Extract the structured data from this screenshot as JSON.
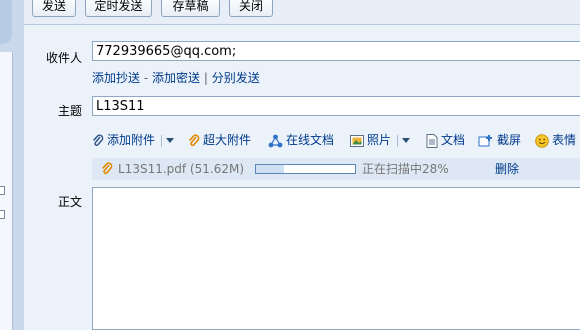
{
  "toolbar": {
    "send": "发送",
    "scheduled_send": "定时发送",
    "save_draft": "存草稿",
    "close": "关闭"
  },
  "recipient": {
    "label": "收件人",
    "value": "772939665@qq.com;"
  },
  "recipient_links": {
    "add_cc": "添加抄送",
    "dash": "-",
    "add_bcc": "添加密送",
    "separator": "|",
    "separate_send": "分别发送"
  },
  "subject": {
    "label": "主题",
    "value": "L13S11"
  },
  "attach_toolbar": {
    "add_attachment": "添加附件",
    "large_attachment": "超大附件",
    "online_doc": "在线文档",
    "photo": "照片",
    "document": "文档",
    "screenshot": "截屏",
    "emoji": "表情"
  },
  "attachment": {
    "filename": "L13S11.pdf (51.62M)",
    "status": "正在扫描中28%",
    "progress": 0.28,
    "delete": "删除"
  },
  "body": {
    "label": "正文",
    "value": ""
  }
}
